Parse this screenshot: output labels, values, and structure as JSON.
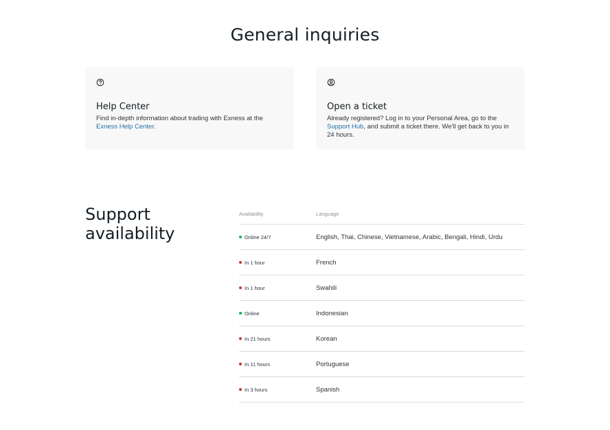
{
  "general": {
    "title": "General inquiries",
    "help_card": {
      "icon": "question-circle-icon",
      "title": "Help Center",
      "text_before": "Find in-depth information about trading with Exness at the ",
      "link": "Exness Help Center",
      "text_after": "."
    },
    "ticket_card": {
      "icon": "user-circle-icon",
      "title": "Open a ticket",
      "text_before": "Already registered? Log in to your Personal Area, go to the ",
      "link": "Support Hub",
      "text_after": ", and submit a ticket there. We'll get back to you in 24 hours."
    }
  },
  "availability": {
    "title_line1": "Support",
    "title_line2": "availability",
    "header_availability": "Availability",
    "header_language": "Language",
    "colors": {
      "online": "#1aae5a",
      "delayed": "#c0392b"
    },
    "rows": [
      {
        "status": "Online 24/7",
        "state": "online",
        "language": "English, Thai, Chinese, Vietnamese, Arabic, Bengali, Hindi, Urdu"
      },
      {
        "status": "In 1 hour",
        "state": "delayed",
        "language": "French"
      },
      {
        "status": "In 1 hour",
        "state": "delayed",
        "language": "Swahili"
      },
      {
        "status": "Online",
        "state": "online",
        "language": "Indonesian"
      },
      {
        "status": "In 21 hours",
        "state": "delayed",
        "language": "Korean"
      },
      {
        "status": "In 11 hours",
        "state": "delayed",
        "language": "Portuguese"
      },
      {
        "status": "In 3 hours",
        "state": "delayed",
        "language": "Spanish"
      }
    ]
  }
}
